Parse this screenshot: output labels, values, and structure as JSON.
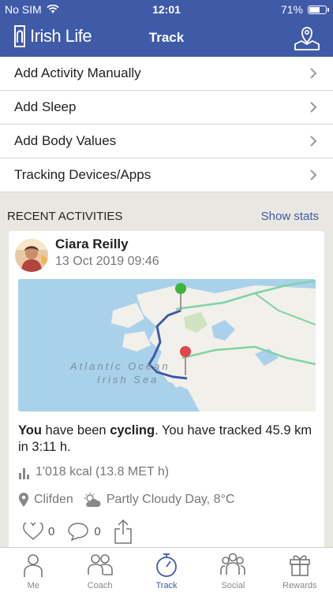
{
  "status": {
    "carrier": "No SIM",
    "time": "12:01",
    "battery": "71%",
    "battery_level": 0.71
  },
  "header": {
    "brand": "Irish Life",
    "title": "Track"
  },
  "menu": [
    {
      "label": "Add Activity Manually"
    },
    {
      "label": "Add Sleep"
    },
    {
      "label": "Add Body Values"
    },
    {
      "label": "Tracking Devices/Apps"
    }
  ],
  "recent": {
    "label": "RECENT ACTIVITIES",
    "show_stats": "Show stats"
  },
  "activity": {
    "name": "Ciara Reilly",
    "date": "13 Oct 2019 09:46",
    "map_label_line1": "Atlantic Ocean",
    "map_label_line2": "Irish Sea",
    "summary_you": "You",
    "summary_1": " have been ",
    "summary_activity": "cycling",
    "summary_2": ". You have tracked 45.9 km in 3:11 h.",
    "kcal": "1'018 kcal (13.8 MET h)",
    "location": "Clifden",
    "weather": "Partly Cloudy Day, 8°C",
    "likes": "0",
    "comments": "0"
  },
  "tabs": [
    {
      "label": "Me",
      "icon": "person-icon"
    },
    {
      "label": "Coach",
      "icon": "coach-icon"
    },
    {
      "label": "Track",
      "icon": "stopwatch-icon"
    },
    {
      "label": "Social",
      "icon": "group-icon"
    },
    {
      "label": "Rewards",
      "icon": "gift-icon"
    }
  ],
  "colors": {
    "brand": "#3f5aa7",
    "route": "#3f5aa7",
    "roads": "#7ed3a6",
    "land": "#f2f0ea",
    "water": "#a9d1ea"
  }
}
